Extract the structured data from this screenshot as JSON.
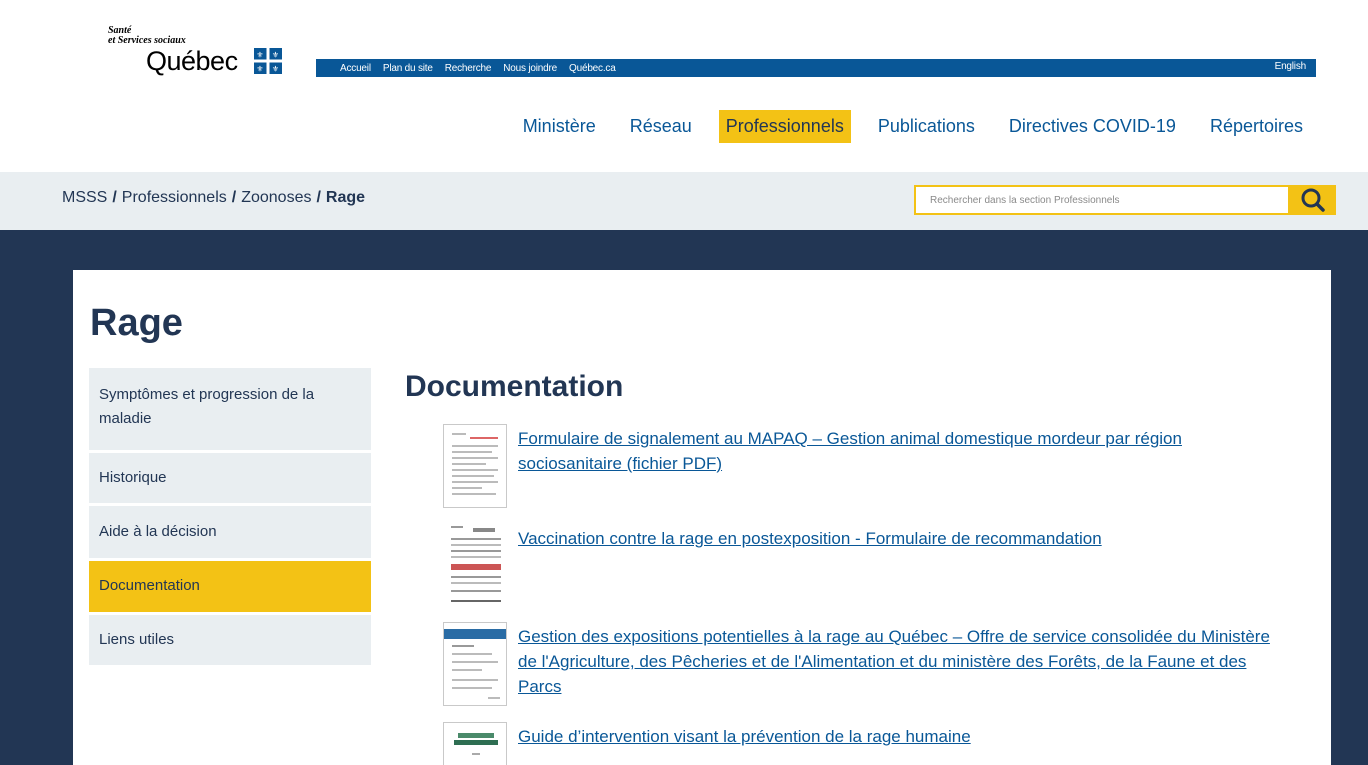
{
  "brand": {
    "line1": "Santé",
    "line2": "et Services sociaux",
    "line3": "Québec"
  },
  "utility_nav": {
    "links": [
      "Accueil",
      "Plan du site",
      "Recherche",
      "Nous joindre",
      "Québec.ca"
    ],
    "language": "English"
  },
  "main_nav": {
    "items": [
      "Ministère",
      "Réseau",
      "Professionnels",
      "Publications",
      "Directives COVID-19",
      "Répertoires"
    ],
    "active": "Professionnels"
  },
  "breadcrumb": {
    "items": [
      "MSSS",
      "Professionnels",
      "Zoonoses"
    ],
    "current": "Rage",
    "separator": "/"
  },
  "search": {
    "placeholder": "Rechercher dans la section Professionnels",
    "icon": "search-icon"
  },
  "page": {
    "title": "Rage"
  },
  "side_nav": {
    "items": [
      "Symptômes et progression de la maladie",
      "Historique",
      "Aide à la décision",
      "Documentation",
      "Liens utiles"
    ],
    "active": "Documentation"
  },
  "content": {
    "heading": "Documentation",
    "documents": [
      {
        "title": "Formulaire de signalement au MAPAQ – Gestion animal domestique mordeur par région sociosanitaire (fichier PDF)"
      },
      {
        "title": "Vaccination contre la rage en postexposition - Formulaire de recommandation"
      },
      {
        "title": "Gestion des expositions potentielles à la rage au Québec – Offre de service consolidée du Ministère de l'Agriculture, des Pêcheries et de l'Alimentation et du ministère des Forêts, de la Faune et des Parcs"
      },
      {
        "title": "Guide d’intervention visant la prévention de la rage humaine"
      }
    ]
  },
  "colors": {
    "primary_blue": "#095797",
    "dark_navy": "#223654",
    "accent_yellow": "#f3c215",
    "light_gray": "#e9eef1"
  }
}
